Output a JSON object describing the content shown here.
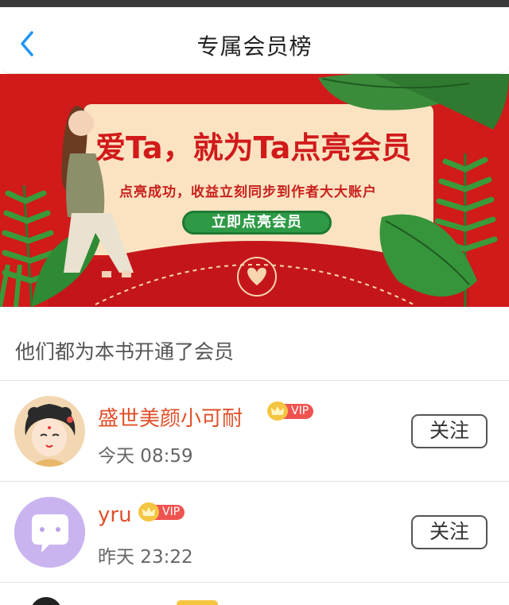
{
  "nav": {
    "title": "专属会员榜"
  },
  "banner": {
    "title": "爱Ta，就为Ta点亮会员",
    "subtitle": "点亮成功，收益立刻同步到作者大大账户",
    "button": "立即点亮会员"
  },
  "section": {
    "label": "他们都为本书开通了会员"
  },
  "members": [
    {
      "name": "盛世美颜小可耐",
      "badge": "VIP",
      "time": "今天 08:59",
      "follow": "关注"
    },
    {
      "name": "yru",
      "badge": "VIP",
      "time": "昨天 23:22",
      "follow": "关注"
    }
  ],
  "icons": {
    "back": "chevron-left-icon",
    "crown": "crown-icon"
  },
  "colors": {
    "accent": "#2196f3",
    "banner_red": "#d11a1a",
    "name_orange": "#e0502a",
    "vip_red": "#ef5350",
    "button_green": "#2e9a46"
  }
}
